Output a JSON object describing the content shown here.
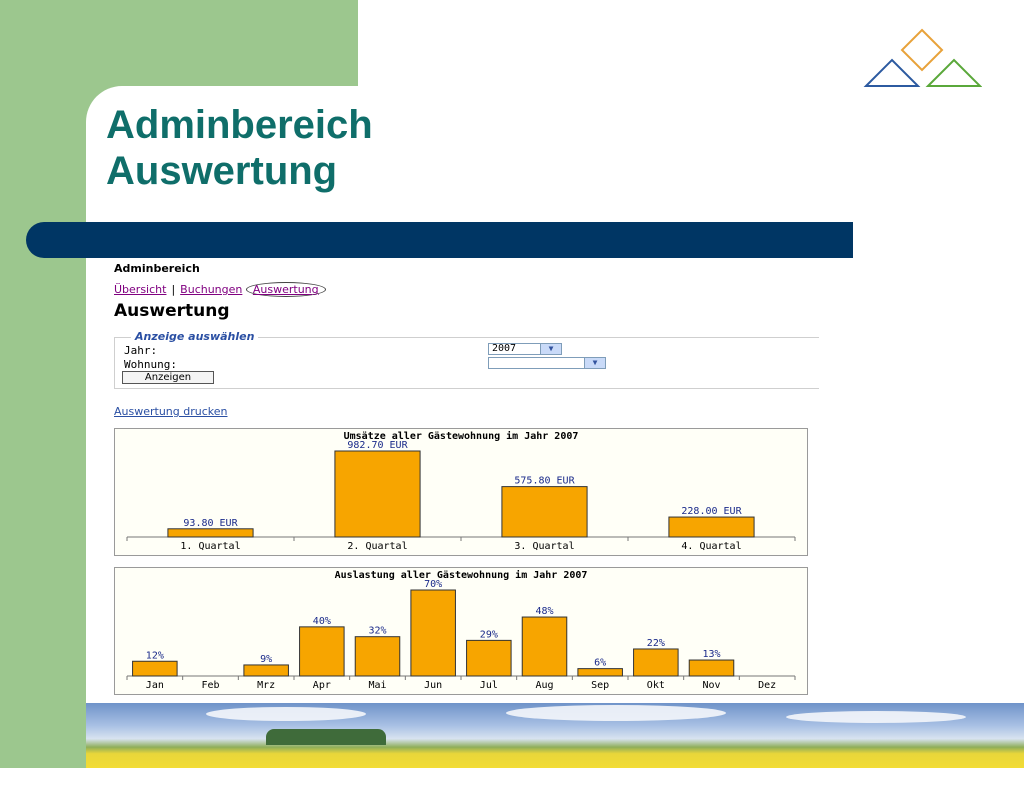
{
  "slide": {
    "title_line1": "Adminbereich",
    "title_line2": "Auswertung",
    "colors": {
      "title": "#0f6e6a",
      "band": "#9cc78e",
      "bar": "#003664",
      "chart_bar": "#f7a500"
    },
    "logo_icon": "triangles-diamond-logo-icon"
  },
  "app": {
    "header": "Adminbereich",
    "nav": {
      "item1": "Übersicht",
      "sep1": "|",
      "item2": "Buchungen",
      "item3": "Auswertung"
    },
    "page_title": "Auswertung",
    "form": {
      "legend": "Anzeige auswählen",
      "year_label": "Jahr:",
      "year_value": "2007",
      "apartment_label": "Wohnung:",
      "apartment_value": "",
      "submit_label": "Anzeigen"
    },
    "print_link": "Auswertung drucken"
  },
  "chart_data": [
    {
      "type": "bar",
      "title": "Umsätze aller Gästewohnung im Jahr 2007",
      "categories": [
        "1. Quartal",
        "2. Quartal",
        "3. Quartal",
        "4. Quartal"
      ],
      "values": [
        93.8,
        982.7,
        575.8,
        228.0
      ],
      "labels": [
        "93.80 EUR",
        "982.70 EUR",
        "575.80 EUR",
        "228.00 EUR"
      ],
      "ylim": [
        0,
        982.7
      ]
    },
    {
      "type": "bar",
      "title": "Auslastung aller Gästewohnung im Jahr 2007",
      "categories": [
        "Jan",
        "Feb",
        "Mrz",
        "Apr",
        "Mai",
        "Jun",
        "Jul",
        "Aug",
        "Sep",
        "Okt",
        "Nov",
        "Dez"
      ],
      "values": [
        12,
        0,
        9,
        40,
        32,
        70,
        29,
        48,
        6,
        22,
        13,
        0
      ],
      "labels": [
        "12%",
        "",
        "9%",
        "40%",
        "32%",
        "70%",
        "29%",
        "48%",
        "6%",
        "22%",
        "13%",
        ""
      ],
      "ylim": [
        0,
        70
      ]
    }
  ]
}
